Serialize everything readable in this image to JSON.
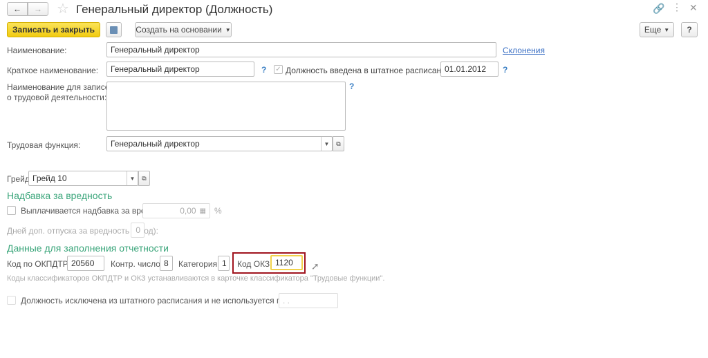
{
  "header": {
    "title": "Генеральный директор (Должность)",
    "back": "←",
    "forward": "→"
  },
  "toolbar": {
    "save_close": "Записать и закрыть",
    "create_based": "Создать на основании",
    "more": "Еще",
    "help": "?"
  },
  "form": {
    "name_label": "Наименование:",
    "name_value": "Генеральный директор",
    "declensions": "Склонения",
    "short_label": "Краткое наименование:",
    "short_value": "Генеральный директор",
    "staff_label": "Должность введена в штатное расписание",
    "staff_date": "01.01.2012",
    "records_label_1": "Наименование для записей",
    "records_label_2": "о трудовой деятельности:",
    "records_value": "",
    "func_label": "Трудовая функция:",
    "func_value": "Генеральный директор",
    "grade_label": "Грейд:",
    "grade_value": "Грейд 10",
    "harm_section": "Надбавка за вредность",
    "harm_pay_label": "Выплачивается надбавка за вредность",
    "harm_pay_value": "0,00",
    "percent": "%",
    "harm_days_label": "Дней доп. отпуска за вредность (в год):",
    "harm_days_value": "0",
    "report_section": "Данные для заполнения отчетности",
    "okpdtr_label": "Код по ОКПДТР:",
    "okpdtr_value": "20560",
    "control_label": "Контр. число:",
    "control_value": "8",
    "category_label": "Категория:",
    "category_value": "1",
    "okz_label": "Код ОКЗ:",
    "okz_value": "1120",
    "note": "Коды классификаторов ОКПДТР и ОКЗ устанавливаются в карточке классификатора \"Трудовые функции\".",
    "excluded_label": "Должность исключена из штатного расписания и не используется после",
    "excluded_date": " .  . ",
    "q": "?"
  },
  "colors": {
    "accent": "#f5d320",
    "highlight": "#a0141e",
    "section": "#3aa57a"
  }
}
